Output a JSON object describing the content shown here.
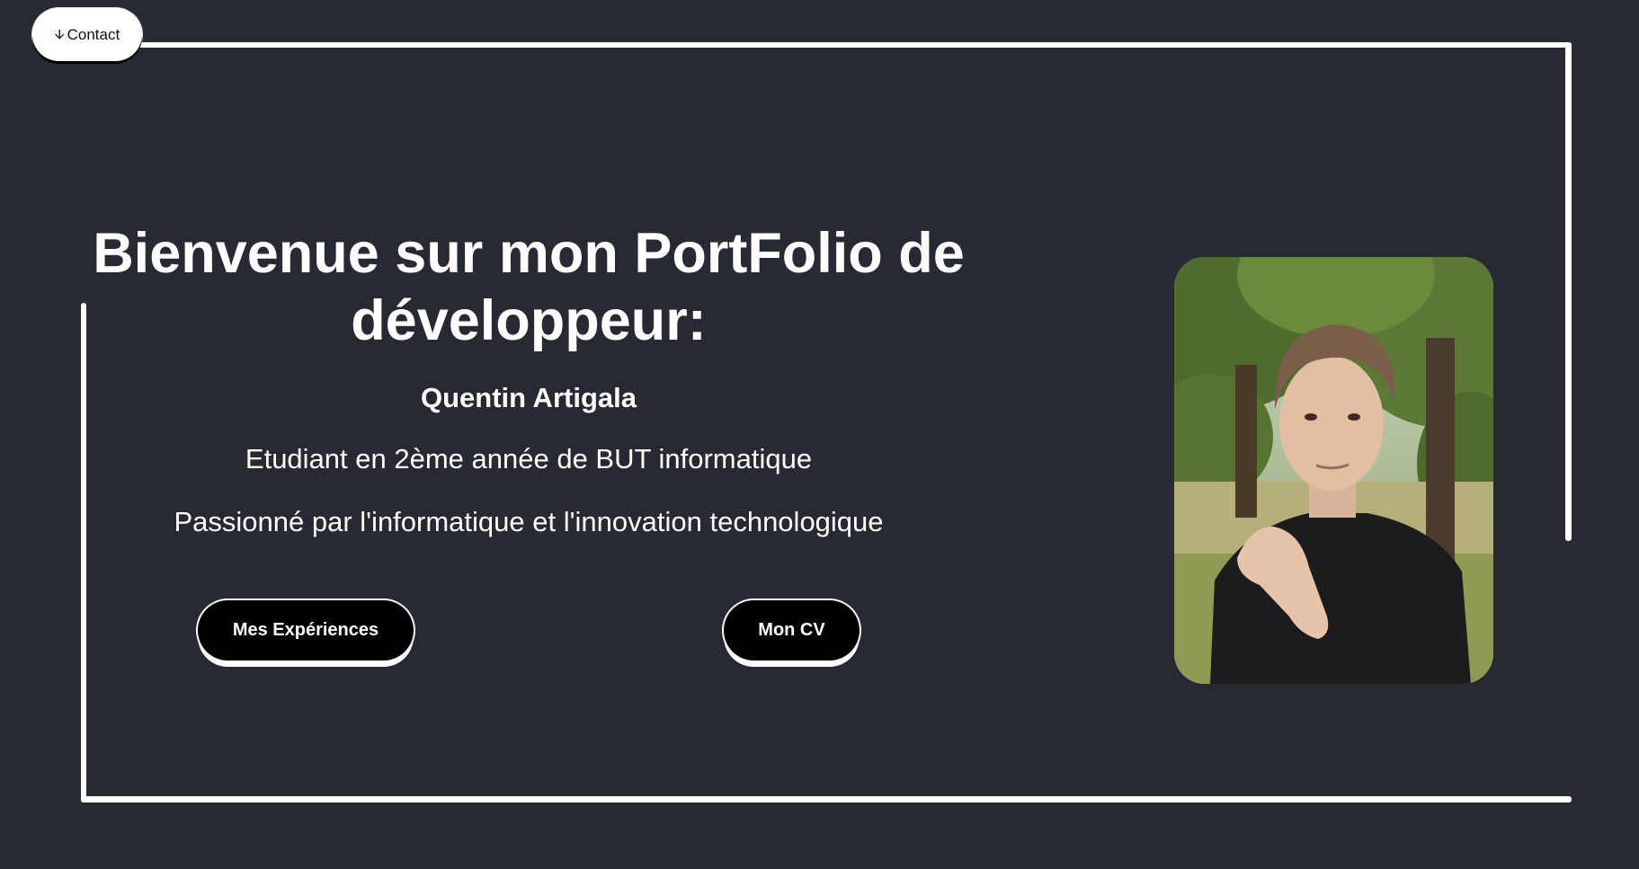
{
  "contact": {
    "label": "Contact",
    "icon": "arrow-down-icon"
  },
  "hero": {
    "title_line1": "Bienvenue sur mon PortFolio de",
    "title_line2": "développeur:",
    "name": "Quentin Artigala",
    "line1": "Etudiant en 2ème année de BUT informatique",
    "line2": "Passionné par l'informatique et l'innovation technologique"
  },
  "buttons": {
    "experiences": "Mes Expériences",
    "cv": "Mon CV"
  },
  "colors": {
    "background": "#272a33",
    "frame": "#ffffff",
    "button_bg": "#000000",
    "button_text": "#ffffff"
  }
}
